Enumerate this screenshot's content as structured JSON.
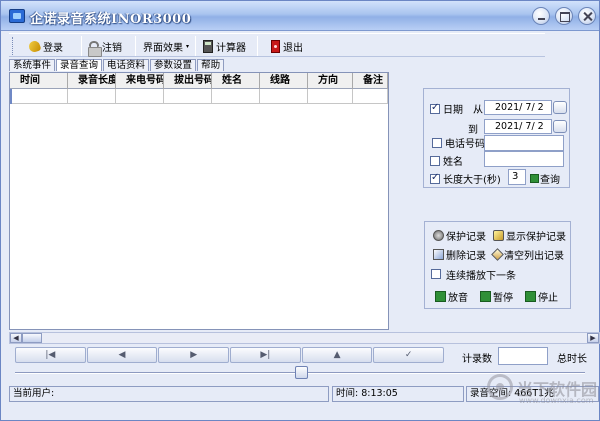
{
  "window": {
    "title": "企诺录音系统INOR3000"
  },
  "toolbar": {
    "login": "登录",
    "logout": "注销",
    "ui_effect": "界面效果",
    "calculator": "计算器",
    "exit": "退出"
  },
  "tabs": [
    "系统事件",
    "录音查询",
    "电话资料",
    "参数设置",
    "帮助"
  ],
  "active_tab": "录音查询",
  "grid": {
    "columns": [
      "时间",
      "录音长度",
      "来电号码",
      "拔出号码",
      "姓名",
      "线路",
      "方向",
      "备注"
    ]
  },
  "filters": {
    "date_label": "日期",
    "from_label": "从",
    "from_value": "2021/ 7/ 2",
    "to_label": "到",
    "to_value": "2021/ 7/ 2",
    "phone_label": "电话号码",
    "name_label": "姓名",
    "length_label": "长度大于(秒)",
    "length_value": "3",
    "query_label": "查询",
    "date_checked": true,
    "length_checked": true
  },
  "operations": {
    "protect": "保护记录",
    "show_protect": "显示保护记录",
    "delete": "删除记录",
    "clear_list": "清空列出记录",
    "continuous": "连续播放下一条",
    "play": "放音",
    "pause": "暂停",
    "stop": "停止"
  },
  "navigator": [
    "|◀",
    "◀",
    "▶",
    "▶|",
    "▲",
    "✓"
  ],
  "counts": {
    "record_count_label": "计录数",
    "total_time_label": "总时长"
  },
  "status": {
    "current_user": "当前用户:",
    "time": "时间: 8:13:05",
    "space": "录音空间: 466T1兆"
  },
  "watermark": {
    "text": "当下软件园",
    "url": "www.downxia.com"
  }
}
